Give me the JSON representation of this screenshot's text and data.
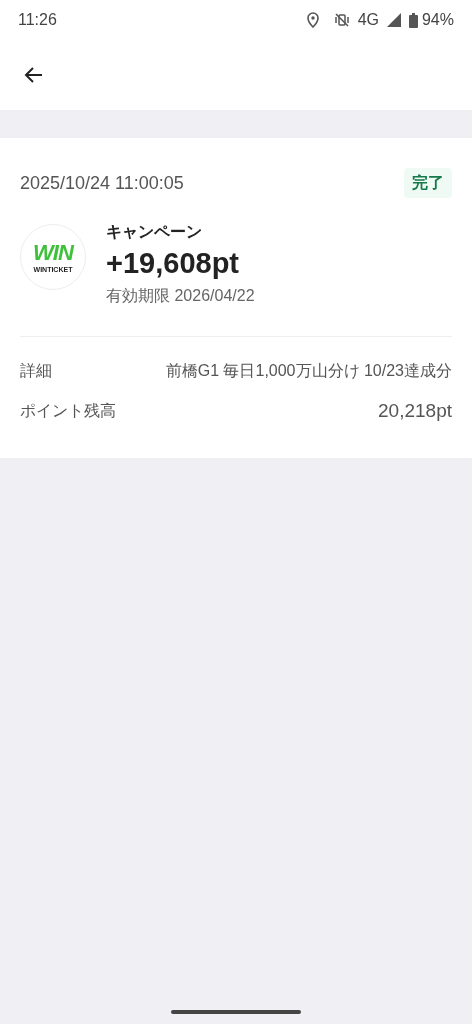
{
  "status_bar": {
    "time": "11:26",
    "network": "4G",
    "battery": "94%"
  },
  "transaction": {
    "datetime": "2025/10/24 11:00:05",
    "status": "完了",
    "logo": {
      "mark": "WIN",
      "caption": "WINTICKET"
    },
    "category": "キャンペーン",
    "amount": "+19,608pt",
    "expiry": "有効期限 2026/04/22"
  },
  "details": [
    {
      "label": "詳細",
      "value": "前橋G1 毎日1,000万山分け 10/23達成分"
    },
    {
      "label": "ポイント残高",
      "value": "20,218pt"
    }
  ]
}
